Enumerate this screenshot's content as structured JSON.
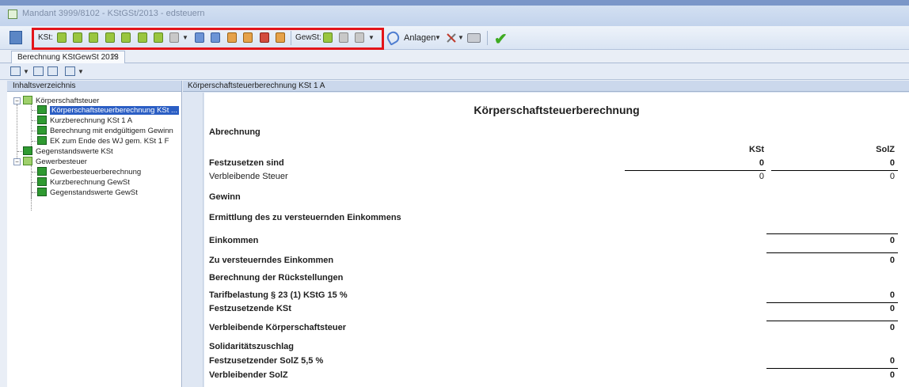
{
  "window": {
    "title": "Mandant 3999/8102 - KStGSt/2013 - edsteuern"
  },
  "toolbar": {
    "kst_label": "KSt:",
    "gewst_label": "GewSt:",
    "anlagen_label": "Anlagen"
  },
  "tab": {
    "label": "Berechnung KStGewSt 2013",
    "close": "✕"
  },
  "left_panel": {
    "header": "Inhaltsverzeichnis",
    "tree": {
      "koerperschaftsteuer": "Körperschaftsteuer",
      "koerperschaftsteuerberechnung": "Körperschaftsteuerberechnung KSt ...",
      "kurzberechnung_kst": "Kurzberechnung KSt 1 A",
      "berechnung_endg": "Berechnung mit endgültigem Gewinn",
      "ek_ende": "EK zum Ende des WJ gem. KSt 1 F",
      "gegenstandswerte_kst": "Gegenstandswerte KSt",
      "gewerbesteuer": "Gewerbesteuer",
      "gewerbesteuerberechnung": "Gewerbesteuerberechnung",
      "kurzberechnung_gewst": "Kurzberechnung GewSt",
      "gegenstandswerte_gewst": "Gegenstandswerte GewSt"
    }
  },
  "right_panel": {
    "header": "Körperschaftsteuerberechnung KSt 1 A",
    "doc_title": "Körperschaftsteuerberechnung",
    "col_kst": "KSt",
    "col_solz": "SolZ",
    "rows": {
      "abrechnung": "Abrechnung",
      "festzusetzen": {
        "label": "Festzusetzen sind",
        "kst": "0",
        "solz": "0"
      },
      "verbleibende_steuer": {
        "label": "Verbleibende Steuer",
        "kst": "0",
        "solz": "0"
      },
      "gewinn": "Gewinn",
      "ermittlung": "Ermittlung des zu versteuernden Einkommens",
      "einkommen": {
        "label": "Einkommen",
        "value": "0"
      },
      "zve": {
        "label": "Zu versteuerndes Einkommen",
        "value": "0"
      },
      "rueckstellungen": "Berechnung der Rückstellungen",
      "tarifbelastung": {
        "label": "Tarifbelastung § 23 (1) KStG 15 %",
        "value": "0"
      },
      "festzusetzende_kst": {
        "label": "Festzusetzende KSt",
        "value": "0"
      },
      "verbleibende_kst": {
        "label": "Verbleibende Körperschaftsteuer",
        "value": "0"
      },
      "solz": "Solidaritätszuschlag",
      "festzusetzender_solz": {
        "label": "Festzusetzender SolZ 5,5 %",
        "value": "0"
      },
      "verbleibender_solz": {
        "label": "Verbleibender SolZ",
        "value": "0"
      }
    }
  }
}
